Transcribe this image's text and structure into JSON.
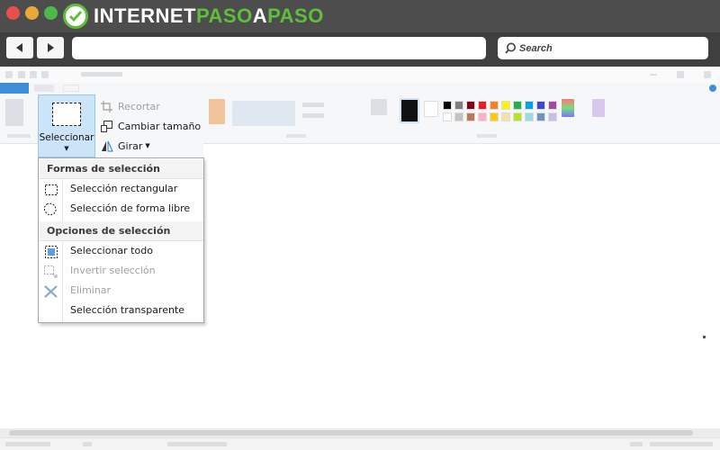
{
  "site": {
    "brand_part1": "INTERNET",
    "brand_part2": "PASO",
    "brand_part3": "A",
    "brand_part4": "PASO"
  },
  "browser": {
    "search_placeholder": "Search"
  },
  "image_tools": {
    "crop_label": "Recortar",
    "resize_label": "Cambiar tamaño",
    "rotate_label": "Girar"
  },
  "select_button": {
    "label": "Seleccionar"
  },
  "select_menu": {
    "shapes_header": "Formas de selección",
    "shapes": [
      {
        "label": "Selección rectangular",
        "icon": "rectangle-selection-icon"
      },
      {
        "label": "Selección de forma libre",
        "icon": "free-form-selection-icon"
      }
    ],
    "options_header": "Opciones de selección",
    "options": [
      {
        "label": "Seleccionar todo",
        "icon": "select-all-icon",
        "enabled": true
      },
      {
        "label": "Invertir selección",
        "icon": "invert-selection-icon",
        "enabled": false
      },
      {
        "label": "Eliminar",
        "icon": "delete-icon",
        "enabled": false
      },
      {
        "label": "Selección transparente",
        "icon": "",
        "enabled": true
      }
    ]
  },
  "colors": {
    "accent_green": "#5fbf3a",
    "file_tab_blue": "#3e8fd8",
    "select_highlight": "#cce4f7"
  },
  "palette": [
    "#000000",
    "#7f7f7f",
    "#880015",
    "#ed1c24",
    "#ff7f27",
    "#fff200",
    "#22b14c",
    "#00a2e8",
    "#3f48cc",
    "#a349a4",
    "#ffffff",
    "#c3c3c3",
    "#b97a57",
    "#ffaec9",
    "#ffc90e",
    "#efe4b0",
    "#b5e61d",
    "#99d9ea",
    "#7092be",
    "#c8bfe7"
  ]
}
